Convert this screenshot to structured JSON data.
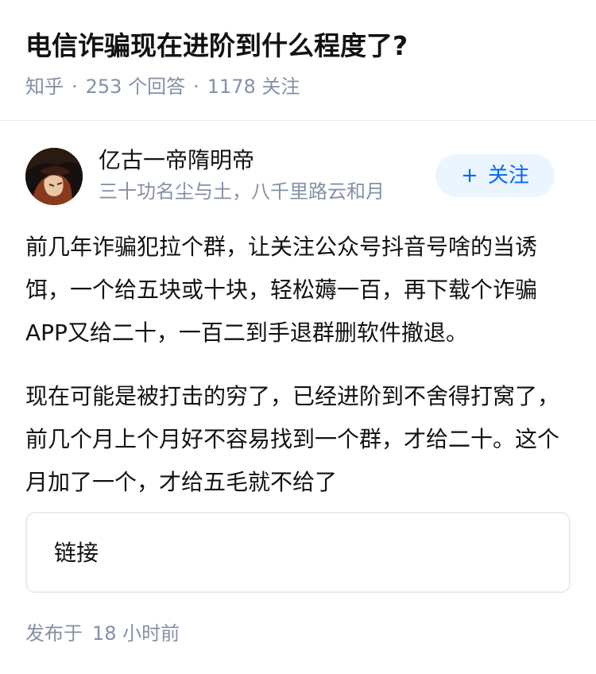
{
  "question": {
    "title": "电信诈骗现在进阶到什么程度了?",
    "source": "知乎",
    "answers_label": "253 个回答",
    "followers_label": "1178 关注",
    "separator": "·"
  },
  "author": {
    "name": "亿古一帝隋明帝",
    "bio": "三十功名尘与土，八千里路云和月",
    "follow_plus": "+",
    "follow_label": "关注"
  },
  "answer": {
    "paragraphs": [
      "前几年诈骗犯拉个群，让关注公众号抖音号啥的当诱饵，一个给五块或十块，轻松薅一百，再下载个诈骗APP又给二十，一百二到手退群删软件撤退。",
      "现在可能是被打击的穷了，已经进阶到不舍得打窝了，前几个月上个月好不容易找到一个群，才给二十。这个月加了一个，才给五毛就不给了"
    ]
  },
  "link_card": {
    "label": "链接"
  },
  "publish": {
    "prefix": "发布于",
    "time": "18 小时前"
  },
  "colors": {
    "accent": "#0066ff",
    "follow_bg": "#ebf5ff",
    "meta_gray": "#8590a6",
    "text": "#121212"
  }
}
